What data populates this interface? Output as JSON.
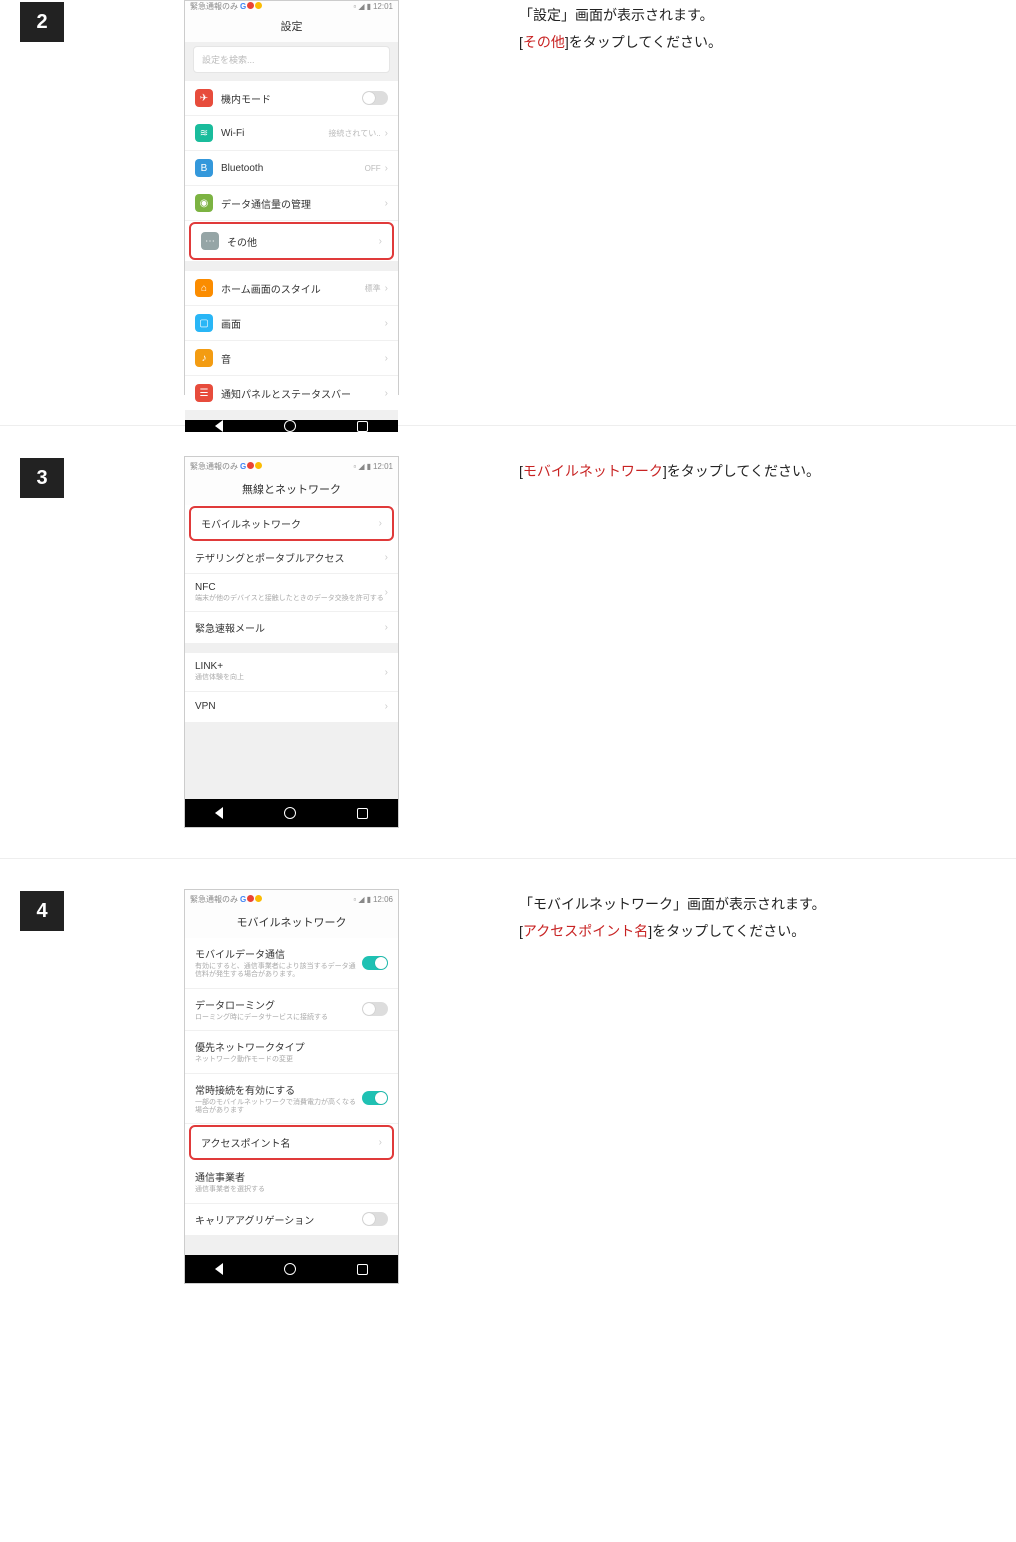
{
  "steps": [
    {
      "num": "2",
      "desc_parts": [
        "「設定」画面が表示されます。",
        "[",
        "その他",
        "]をタップしてください。"
      ],
      "phone": {
        "status_left": "緊急通報のみ",
        "time": "12:01",
        "title": "設定",
        "search_placeholder": "設定を検索...",
        "groups": [
          [
            {
              "icon": "airplane",
              "icon_class": "ic-red",
              "label": "機内モード",
              "toggle": false
            },
            {
              "icon": "wifi",
              "icon_class": "ic-teal",
              "label": "Wi-Fi",
              "value": "接続されてい..",
              "chev": true
            },
            {
              "icon": "bt",
              "icon_class": "ic-blue",
              "label": "Bluetooth",
              "value": "OFF",
              "chev": true
            },
            {
              "icon": "data",
              "icon_class": "ic-green",
              "label": "データ通信量の管理",
              "chev": true
            },
            {
              "icon": "more",
              "icon_class": "ic-grey",
              "label": "その他",
              "chev": true,
              "highlight": true
            }
          ],
          [
            {
              "icon": "home",
              "icon_class": "ic-orange2",
              "label": "ホーム画面のスタイル",
              "value": "標準",
              "chev": true
            },
            {
              "icon": "screen",
              "icon_class": "ic-lblue",
              "label": "画面",
              "chev": true
            },
            {
              "icon": "sound",
              "icon_class": "ic-orange",
              "label": "音",
              "chev": true
            },
            {
              "icon": "notif",
              "icon_class": "ic-red",
              "label": "通知パネルとステータスバー",
              "chev": true
            }
          ]
        ]
      }
    },
    {
      "num": "3",
      "desc_parts": [
        "[",
        "モバイルネットワーク",
        "]をタップしてください。"
      ],
      "phone": {
        "status_left": "緊急通報のみ",
        "time": "12:01",
        "title": "無線とネットワーク",
        "groups": [
          [
            {
              "label": "モバイルネットワーク",
              "chev": true,
              "highlight": true
            },
            {
              "label": "テザリングとポータブルアクセス",
              "chev": true
            },
            {
              "label": "NFC",
              "sub": "端末が他のデバイスと接触したときのデータ交換を許可する",
              "chev": true
            },
            {
              "label": "緊急速報メール",
              "chev": true
            }
          ],
          [
            {
              "label": "LINK+",
              "sub": "通信体験を向上",
              "chev": true
            },
            {
              "label": "VPN",
              "chev": true
            }
          ]
        ]
      }
    },
    {
      "num": "4",
      "desc_parts": [
        "「モバイルネットワーク」画面が表示されます。",
        "[",
        "アクセスポイント名",
        "]をタップしてください。"
      ],
      "phone": {
        "status_left": "緊急通報のみ",
        "time": "12:06",
        "title": "モバイルネットワーク",
        "groups": [
          [
            {
              "label": "モバイルデータ通信",
              "sub": "有効にすると、通信事業者により該当するデータ通信料が発生する場合があります。",
              "toggle": true,
              "toggle_on": true
            },
            {
              "label": "データローミング",
              "sub": "ローミング時にデータサービスに接続する",
              "toggle": true,
              "toggle_on": false
            },
            {
              "label": "優先ネットワークタイプ",
              "sub": "ネットワーク動作モードの変更"
            },
            {
              "label": "常時接続を有効にする",
              "sub": "一部のモバイルネットワークで消費電力が高くなる場合があります",
              "toggle": true,
              "toggle_on": true
            },
            {
              "label": "アクセスポイント名",
              "chev": true,
              "highlight": true
            },
            {
              "label": "通信事業者",
              "sub": "通信事業者を選択する"
            },
            {
              "label": "キャリアアグリゲーション",
              "toggle": true,
              "toggle_on": false
            }
          ]
        ]
      }
    }
  ]
}
